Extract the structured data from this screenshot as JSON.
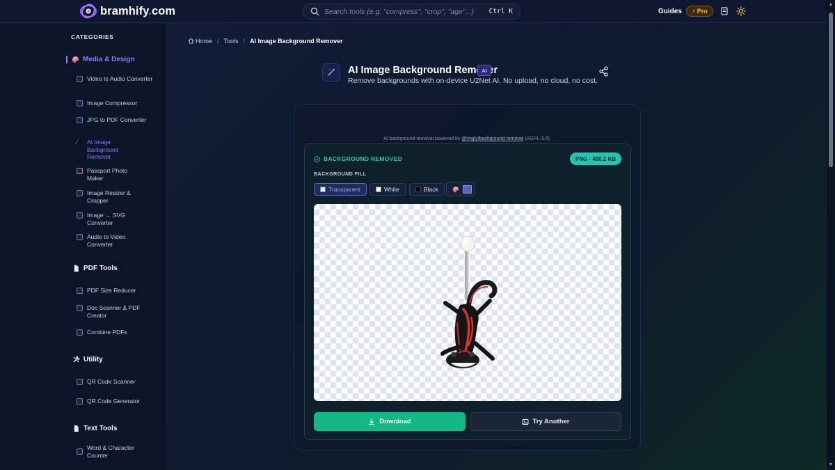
{
  "brand": {
    "name_part1": "bramhify",
    "name_dot": ".",
    "name_part2": "com"
  },
  "search": {
    "placeholder": "Search tools (e.g. \"compress\", \"crop\", \"age\"...)",
    "shortcut": "Ctrl K"
  },
  "topnav": {
    "guides": "Guides",
    "pro": "Pro"
  },
  "sidebar": {
    "heading": "CATEGORIES",
    "groups": [
      {
        "label": "Media & Design",
        "icon": "palette-icon",
        "items": [
          {
            "label": "Video to Audio Converter"
          },
          {
            "label": "Image Compressor"
          },
          {
            "label": "JPG to PDF Converter"
          },
          {
            "label": "AI Image Background Remover"
          },
          {
            "label": "Passport Photo Maker"
          },
          {
            "label": "Image Resizer & Cropper"
          },
          {
            "label": "Image → SVG Converter"
          },
          {
            "label": "Audio to Video Converter"
          }
        ]
      },
      {
        "label": "PDF Tools",
        "icon": "document-icon",
        "items": [
          {
            "label": "PDF Size Reducer"
          },
          {
            "label": "Doc Scanner & PDF Creator"
          },
          {
            "label": "Combine PDFs"
          }
        ]
      },
      {
        "label": "Utility",
        "icon": "tools-icon",
        "items": [
          {
            "label": "QR Code Scanner"
          },
          {
            "label": "QR Code Generator"
          }
        ]
      },
      {
        "label": "Text Tools",
        "icon": "document-icon",
        "items": [
          {
            "label": "Word & Character Counter"
          }
        ]
      }
    ]
  },
  "breadcrumb": {
    "home": "Home",
    "tools": "Tools",
    "current": "AI Image Background Remover",
    "sep": "/"
  },
  "tool": {
    "title": "AI Image Background Remover",
    "badge": "AI",
    "subtitle": "Remove backgrounds with on-device U2Net AI. No upload, no cloud, no cost."
  },
  "powered": {
    "prefix": "AI background removal powered by ",
    "link": "@imgly/background-removal",
    "suffix": " (AGPL-3.0)."
  },
  "result": {
    "status": "BACKGROUND REMOVED",
    "size_pill": "PNG · 498.2 KB",
    "fill_label": "BACKGROUND FILL",
    "fill_options": [
      "Transparent",
      "White",
      "Black"
    ],
    "selected_fill": "Transparent",
    "custom_color": "#5a61b8"
  },
  "actions": {
    "download": "Download",
    "try_another": "Try Another"
  },
  "colors": {
    "accent": "#8f7bff",
    "success": "#14b884",
    "teal": "#1fc6b2"
  }
}
